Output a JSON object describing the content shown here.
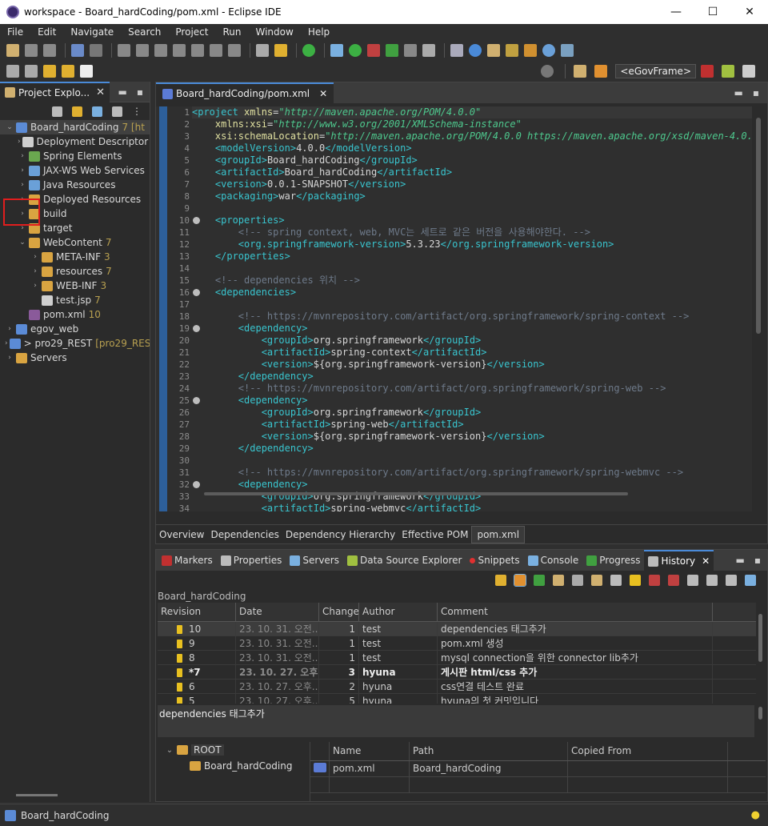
{
  "window": {
    "title": "workspace - Board_hardCoding/pom.xml - Eclipse IDE",
    "min": "—",
    "max": "☐",
    "close": "✕"
  },
  "menu": [
    "File",
    "Edit",
    "Navigate",
    "Search",
    "Project",
    "Run",
    "Window",
    "Help"
  ],
  "egov_label": "<eGovFrame>",
  "explorer": {
    "tab_label": "Project Explo...",
    "tree": [
      {
        "label": "Board_hardCoding",
        "badge": "7 [ht",
        "indent": 0,
        "twisty": "⌄",
        "icon": "proj",
        "selected": true
      },
      {
        "label": "Deployment Descriptor",
        "badge": "",
        "indent": 1,
        "twisty": "›",
        "icon": "file"
      },
      {
        "label": "Spring Elements",
        "badge": "",
        "indent": 1,
        "twisty": "›",
        "icon": "spring"
      },
      {
        "label": "JAX-WS Web Services",
        "badge": "",
        "indent": 1,
        "twisty": "›",
        "icon": "java"
      },
      {
        "label": "Java Resources",
        "badge": "",
        "indent": 1,
        "twisty": "›",
        "icon": "java"
      },
      {
        "label": "Deployed Resources",
        "badge": "",
        "indent": 1,
        "twisty": "›",
        "icon": "folder"
      },
      {
        "label": "build",
        "badge": "",
        "indent": 1,
        "twisty": "›",
        "icon": "folder"
      },
      {
        "label": "target",
        "badge": "",
        "indent": 1,
        "twisty": "›",
        "icon": "folder"
      },
      {
        "label": "WebContent",
        "badge": "7",
        "indent": 1,
        "twisty": "⌄",
        "icon": "folder"
      },
      {
        "label": "META-INF",
        "badge": "3",
        "indent": 2,
        "twisty": "›",
        "icon": "folder"
      },
      {
        "label": "resources",
        "badge": "7",
        "indent": 2,
        "twisty": "›",
        "icon": "folder"
      },
      {
        "label": "WEB-INF",
        "badge": "3",
        "indent": 2,
        "twisty": "›",
        "icon": "folder"
      },
      {
        "label": "test.jsp",
        "badge": "7",
        "indent": 2,
        "twisty": "",
        "icon": "file"
      },
      {
        "label": "pom.xml",
        "badge": "10",
        "indent": 1,
        "twisty": "",
        "icon": "xml"
      },
      {
        "label": "egov_web",
        "badge": "",
        "indent": 0,
        "twisty": "›",
        "icon": "proj"
      },
      {
        "label": "> pro29_REST",
        "badge": "[pro29_REST",
        "indent": 0,
        "twisty": "›",
        "icon": "proj"
      },
      {
        "label": "Servers",
        "badge": "",
        "indent": 0,
        "twisty": "›",
        "icon": "folder"
      }
    ]
  },
  "editor": {
    "tab_label": "Board_hardCoding/pom.xml",
    "bottom_tabs": [
      "Overview",
      "Dependencies",
      "Dependency Hierarchy",
      "Effective POM",
      "pom.xml"
    ],
    "active_bottom_tab": 4,
    "lines": [
      [
        [
          "t",
          "<project "
        ],
        [
          "a",
          "xmlns"
        ],
        [
          "p",
          "="
        ],
        [
          "v",
          "\"http://maven.apache.org/POM/4.0.0\""
        ]
      ],
      [
        [
          "p",
          "    "
        ],
        [
          "a",
          "xmlns:xsi"
        ],
        [
          "p",
          "="
        ],
        [
          "v",
          "\"http://www.w3.org/2001/XMLSchema-instance\""
        ]
      ],
      [
        [
          "p",
          "    "
        ],
        [
          "a",
          "xsi:schemaLocation"
        ],
        [
          "p",
          "="
        ],
        [
          "v",
          "\"http://maven.apache.org/POM/4.0.0 https://maven.apache.org/xsd/maven-4.0.0"
        ]
      ],
      [
        [
          "p",
          "    "
        ],
        [
          "t",
          "<modelVersion>"
        ],
        [
          "p",
          "4.0.0"
        ],
        [
          "t",
          "</modelVersion>"
        ]
      ],
      [
        [
          "p",
          "    "
        ],
        [
          "t",
          "<groupId>"
        ],
        [
          "p",
          "Board_hardCoding"
        ],
        [
          "t",
          "</groupId>"
        ]
      ],
      [
        [
          "p",
          "    "
        ],
        [
          "t",
          "<artifactId>"
        ],
        [
          "p",
          "Board_hardCoding"
        ],
        [
          "t",
          "</artifactId>"
        ]
      ],
      [
        [
          "p",
          "    "
        ],
        [
          "t",
          "<version>"
        ],
        [
          "p",
          "0.0.1-SNAPSHOT"
        ],
        [
          "t",
          "</version>"
        ]
      ],
      [
        [
          "p",
          "    "
        ],
        [
          "t",
          "<packaging>"
        ],
        [
          "p",
          "war"
        ],
        [
          "t",
          "</packaging>"
        ]
      ],
      [
        [
          "p",
          ""
        ]
      ],
      [
        [
          "p",
          "    "
        ],
        [
          "t",
          "<properties>"
        ]
      ],
      [
        [
          "p",
          "        "
        ],
        [
          "c",
          "<!-- spring context, web, MVC는 세트로 같은 버전을 사용해야한다. -->"
        ]
      ],
      [
        [
          "p",
          "        "
        ],
        [
          "t",
          "<org.springframework-version>"
        ],
        [
          "p",
          "5.3.23"
        ],
        [
          "t",
          "</org.springframework-version>"
        ]
      ],
      [
        [
          "p",
          "    "
        ],
        [
          "t",
          "</properties>"
        ]
      ],
      [
        [
          "p",
          ""
        ]
      ],
      [
        [
          "p",
          "    "
        ],
        [
          "c",
          "<!-- dependencies 위치 -->"
        ]
      ],
      [
        [
          "p",
          "    "
        ],
        [
          "t",
          "<dependencies>"
        ]
      ],
      [
        [
          "p",
          ""
        ]
      ],
      [
        [
          "p",
          "        "
        ],
        [
          "c",
          "<!-- https://mvnrepository.com/artifact/org.springframework/spring-context -->"
        ]
      ],
      [
        [
          "p",
          "        "
        ],
        [
          "t",
          "<dependency>"
        ]
      ],
      [
        [
          "p",
          "            "
        ],
        [
          "t",
          "<groupId>"
        ],
        [
          "p",
          "org.springframework"
        ],
        [
          "t",
          "</groupId>"
        ]
      ],
      [
        [
          "p",
          "            "
        ],
        [
          "t",
          "<artifactId>"
        ],
        [
          "p",
          "spring-context"
        ],
        [
          "t",
          "</artifactId>"
        ]
      ],
      [
        [
          "p",
          "            "
        ],
        [
          "t",
          "<version>"
        ],
        [
          "p",
          "${org.springframework-version}"
        ],
        [
          "t",
          "</version>"
        ]
      ],
      [
        [
          "p",
          "        "
        ],
        [
          "t",
          "</dependency>"
        ]
      ],
      [
        [
          "p",
          "        "
        ],
        [
          "c",
          "<!-- https://mvnrepository.com/artifact/org.springframework/spring-web -->"
        ]
      ],
      [
        [
          "p",
          "        "
        ],
        [
          "t",
          "<dependency>"
        ]
      ],
      [
        [
          "p",
          "            "
        ],
        [
          "t",
          "<groupId>"
        ],
        [
          "p",
          "org.springframework"
        ],
        [
          "t",
          "</groupId>"
        ]
      ],
      [
        [
          "p",
          "            "
        ],
        [
          "t",
          "<artifactId>"
        ],
        [
          "p",
          "spring-web"
        ],
        [
          "t",
          "</artifactId>"
        ]
      ],
      [
        [
          "p",
          "            "
        ],
        [
          "t",
          "<version>"
        ],
        [
          "p",
          "${org.springframework-version}"
        ],
        [
          "t",
          "</version>"
        ]
      ],
      [
        [
          "p",
          "        "
        ],
        [
          "t",
          "</dependency>"
        ]
      ],
      [
        [
          "p",
          ""
        ]
      ],
      [
        [
          "p",
          "        "
        ],
        [
          "c",
          "<!-- https://mvnrepository.com/artifact/org.springframework/spring-webmvc -->"
        ]
      ],
      [
        [
          "p",
          "        "
        ],
        [
          "t",
          "<dependency>"
        ]
      ],
      [
        [
          "p",
          "            "
        ],
        [
          "t",
          "<groupId>"
        ],
        [
          "p",
          "org.springframework"
        ],
        [
          "t",
          "</groupId>"
        ]
      ],
      [
        [
          "p",
          "            "
        ],
        [
          "t",
          "<artifactId>"
        ],
        [
          "p",
          "spring-webmvc"
        ],
        [
          "t",
          "</artifactId>"
        ]
      ]
    ],
    "fold_lines": [
      1,
      10,
      16,
      19,
      25,
      32
    ]
  },
  "views": {
    "tabs": [
      "Markers",
      "Properties",
      "Servers",
      "Data Source Explorer",
      "Snippets",
      "Console",
      "Progress",
      "History"
    ],
    "active": 7
  },
  "history": {
    "resource": "Board_hardCoding",
    "columns": [
      "Revision",
      "Date",
      "Changes",
      "Author",
      "Comment"
    ],
    "rows": [
      {
        "rev": "10",
        "date": "23. 10. 31. 오전...",
        "changes": "1",
        "author": "test",
        "comment": "dependencies 태그추가",
        "selected": true,
        "bold": false
      },
      {
        "rev": "9",
        "date": "23. 10. 31. 오전...",
        "changes": "1",
        "author": "test",
        "comment": "pom.xml 생성",
        "selected": false,
        "bold": false
      },
      {
        "rev": "8",
        "date": "23. 10. 31. 오전...",
        "changes": "1",
        "author": "test",
        "comment": "mysql connection을 위한 connector lib추가",
        "selected": false,
        "bold": false
      },
      {
        "rev": "*7",
        "date": "23. 10. 27. 오후...",
        "changes": "3",
        "author": "hyuna",
        "comment": "게시판 html/css 추가",
        "selected": false,
        "bold": true
      },
      {
        "rev": "6",
        "date": "23. 10. 27. 오후...",
        "changes": "2",
        "author": "hyuna",
        "comment": "css연결 테스트 완료",
        "selected": false,
        "bold": false
      },
      {
        "rev": "5",
        "date": "23. 10. 27. 오후...",
        "changes": "5",
        "author": "hyuna",
        "comment": "hyuna의 첫 커밋입니다",
        "selected": false,
        "bold": false
      }
    ],
    "comment_text": "dependencies 태그추가",
    "root_tree": {
      "root": "ROOT",
      "child": "Board_hardCoding"
    },
    "file_columns": [
      "Name",
      "Path",
      "Copied From"
    ],
    "files": [
      {
        "name": "pom.xml",
        "path": "Board_hardCoding",
        "copied_from": ""
      }
    ]
  },
  "status": {
    "text": "Board_hardCoding"
  },
  "colors": {
    "accent": "#4a8ad8",
    "highlight": "#e01e1e",
    "revision_icon": "#e8c020"
  }
}
